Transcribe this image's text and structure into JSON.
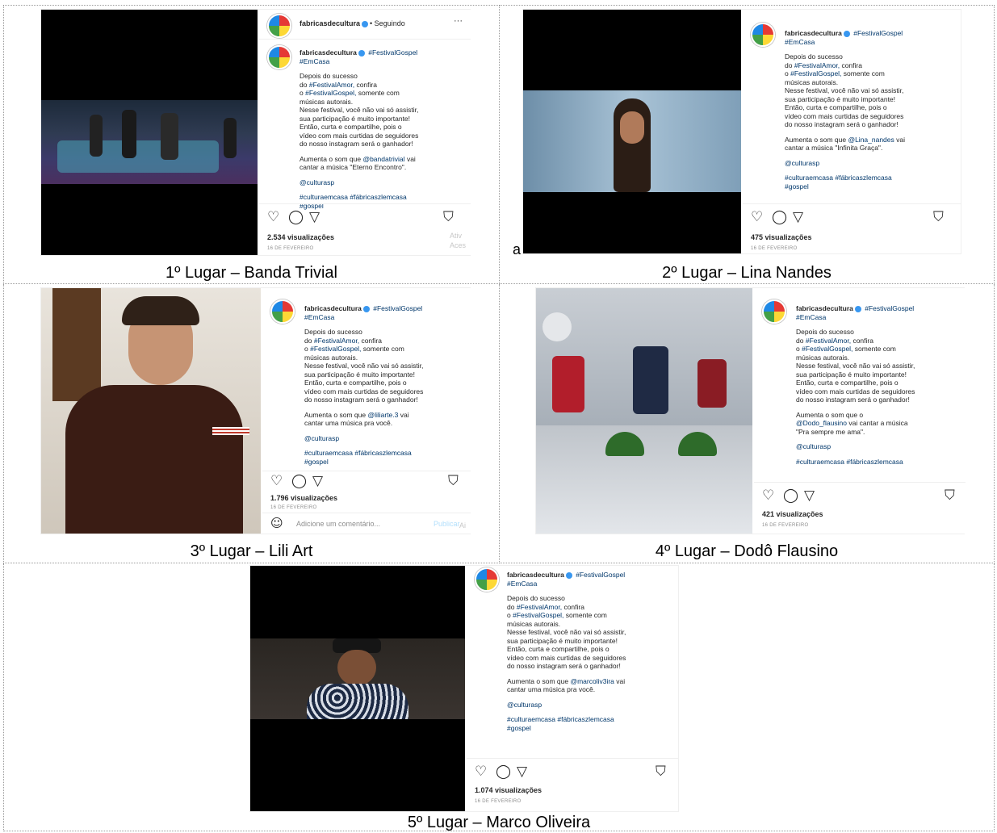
{
  "username": "fabricasdecultura",
  "following": "• Seguindo",
  "more": "···",
  "tag_festival": "#FestivalGospel",
  "tag_emcasa": "#EmCasa",
  "common": {
    "intro": "Depois do sucesso",
    "do": "do",
    "festival_amor": "#FestivalAmor,",
    "confira": "confira",
    "o": "o",
    "festival_gospel": "#FestivalGospel,",
    "somente": "somente com",
    "musicas": "músicas autorais.",
    "nesse": "Nesse festival, você não vai só assistir,",
    "participacao": "sua participação é muito importante!",
    "entao": "Então, curta e compartilhe, pois o",
    "video": "vídeo com mais curtidas de seguidores",
    "nosso": "do nosso instagram será o ganhador!",
    "culturasp": "@culturasp",
    "hashtags": "#culturaemcasa #fábricaszlemcasa",
    "gospel": "#gospel"
  },
  "posts": [
    {
      "caption": "1º Lugar – Banda Trivial",
      "aumenta": "Aumenta o som que",
      "handle": "@bandatrivial",
      "after": "vai",
      "song": "cantar a música \"Eterno Encontro\".",
      "views": "2.534 visualizações",
      "date": "16 DE FEVEREIRO",
      "ativ": "Ativ",
      "aces": "Aces"
    },
    {
      "caption": "2º Lugar – Lina Nandes",
      "aumenta": "Aumenta o som que",
      "handle": "@Lina_nandes",
      "after": "vai",
      "song": "cantar a música \"Infinita Graça\".",
      "views": "475 visualizações",
      "date": "16 DE FEVEREIRO",
      "stray": "a"
    },
    {
      "caption": "3º Lugar – Lili Art",
      "aumenta": "Aumenta o som que",
      "handle": "@liliarte.3",
      "after": "vai",
      "song": "cantar uma música pra você.",
      "views": "1.796 visualizações",
      "date": "16 DE FEVEREIRO",
      "comment_placeholder": "Adicione um comentário...",
      "publish": "Publicar",
      "ai": "Ai"
    },
    {
      "caption": "4º Lugar – Dodô Flausino",
      "aumenta": "Aumenta o som que o",
      "handle": "@Dodo_flausino",
      "after": "vai cantar a música",
      "song": "\"Pra sempre me ama\".",
      "views": "421 visualizações",
      "date": "16 DE FEVEREIRO"
    },
    {
      "caption": "5º Lugar – Marco Oliveira",
      "aumenta": "Aumenta o som que",
      "handle": "@marcoliv3ira",
      "after": "vai",
      "song": "cantar uma música pra você.",
      "views": "1.074 visualizações",
      "date": "16 DE FEVEREIRO"
    }
  ],
  "icons": {
    "heart": "heart-icon",
    "comment": "comment-icon",
    "share": "share-icon",
    "save": "bookmark-icon",
    "smiley": "smiley-icon"
  }
}
